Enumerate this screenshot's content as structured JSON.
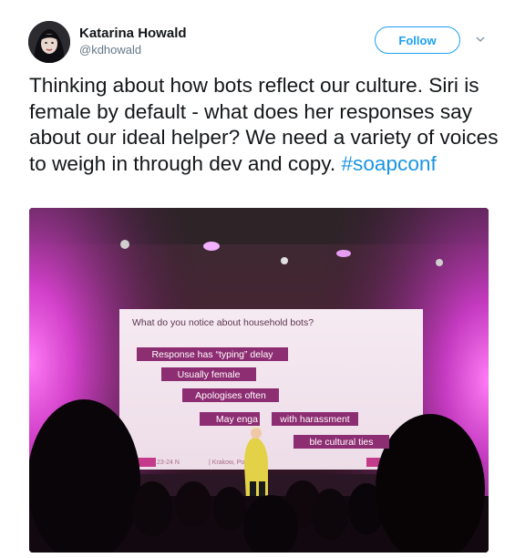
{
  "user": {
    "name": "Katarina Howald",
    "handle": "@kdhowald"
  },
  "follow_label": "Follow",
  "tweet": {
    "text": "Thinking about how bots reflect our culture. Siri is female by default - what does her responses say about our ideal helper? We need a variety of voices to weigh in through dev and copy. ",
    "hashtag": "#soapconf"
  },
  "slide": {
    "title": "What do you notice about household bots?",
    "items": [
      "Response has “typing” delay",
      "Usually female",
      "Apologises often",
      "May enga",
      "with harassment",
      "ble cultural ties"
    ],
    "footer_date": "23-24 N",
    "footer_location": "| Krakow, Po"
  },
  "icons": {
    "chevron": "chevron-down-icon"
  },
  "colors": {
    "accent": "#1da1f2",
    "hashtag": "#1b95e0",
    "slide_label": "#8d2d72",
    "stage_light": "#d93bd0"
  }
}
